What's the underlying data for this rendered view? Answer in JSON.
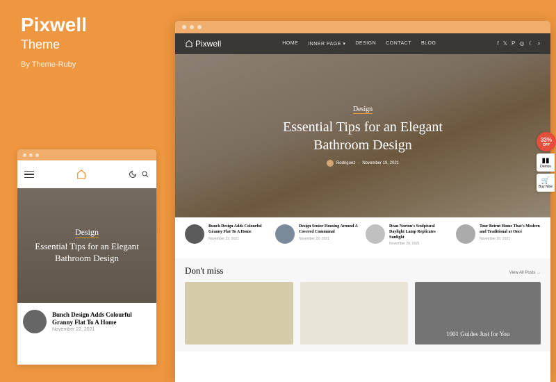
{
  "promo": {
    "title": "Pixwell",
    "subtitle": "Theme",
    "byline": "By Theme-Ruby"
  },
  "nav": {
    "items": [
      "HOME",
      "INNER PAGE",
      "DESIGN",
      "CONTACT",
      "BLOG"
    ],
    "logo": "Pixwell"
  },
  "hero": {
    "category": "Design",
    "title": "Essential Tips for an Elegant Bathroom Design",
    "author": "Rodriguez",
    "date": "November 19, 2021"
  },
  "cards": [
    {
      "title": "Bunch Design Adds Colourful Granny Flat To A Home",
      "date": "November 22, 2021"
    },
    {
      "title": "Design Senior Housing Around A Covered Communal",
      "date": "November 22, 2021"
    },
    {
      "title": "Dean Norton's Sculptural Daylight Lamp Replicates Sunlight",
      "date": "November 20, 2021"
    },
    {
      "title": "Tour Beirut Home That's Modern and Traditional at Once",
      "date": "November 20, 2021"
    }
  ],
  "section": {
    "title": "Don't miss",
    "link": "View All Posts →",
    "feature_title": "1001 Guides Just for You"
  },
  "badges": {
    "discount": "33%",
    "discount_sub": "OFF",
    "demos": "Demos",
    "buy": "Buy Now"
  },
  "mobile": {
    "card_title": "Bunch Design Adds Colourful Granny Flat To A Home",
    "card_date": "November 22, 2021"
  }
}
